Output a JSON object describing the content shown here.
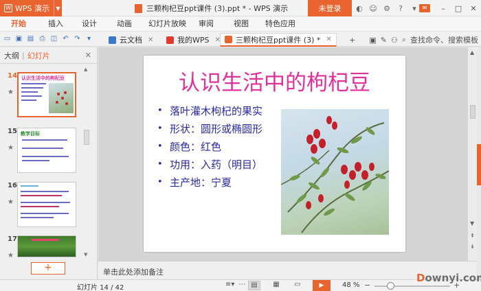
{
  "app": {
    "name": "WPS 演示",
    "document_title": "三颗枸杞豆ppt课件 (3).ppt * - WPS 演示",
    "login_label": "未登录"
  },
  "menu": {
    "items": [
      "开始",
      "插入",
      "设计",
      "动画",
      "幻灯片放映",
      "审阅",
      "视图",
      "特色应用"
    ],
    "active": "开始"
  },
  "tabs": [
    {
      "label": "云文档",
      "icon": "cloud-doc-icon",
      "color": "#3a78c9"
    },
    {
      "label": "我的WPS",
      "icon": "wps-logo-icon",
      "color": "#e23b2e"
    },
    {
      "label": "三颗枸杞豆ppt课件 (3) *",
      "icon": "ppt-file-icon",
      "color": "#e8632e",
      "active": true
    }
  ],
  "toolbar": {
    "search_label": "查找命令、搜索模板"
  },
  "left_panel": {
    "tab_outline": "大纲",
    "tab_slides": "幻灯片",
    "slides": [
      {
        "number": "14",
        "title": "认识生活中的枸杞豆",
        "current": true
      },
      {
        "number": "15",
        "title": "教学目标",
        "current": false
      },
      {
        "number": "16",
        "title": "",
        "current": false
      },
      {
        "number": "17",
        "title": "",
        "current": false
      }
    ],
    "add_label": "+"
  },
  "slide": {
    "title": "认识生活中的枸杞豆",
    "bullets": [
      "落叶灌木枸杞的果实",
      "形状：圆形或椭圆形",
      "颜色：红色",
      "功用：入药（明目）",
      "主产地：宁夏"
    ]
  },
  "notes": {
    "placeholder": "单击此处添加备注"
  },
  "status": {
    "slide_counter": "幻灯片 14 / 42",
    "zoom": "48 %",
    "zoom_level": 0.48
  },
  "watermark": {
    "text_a": "D",
    "text_b": "ownyi.com"
  },
  "colors": {
    "accent": "#e8632e",
    "title_pink": "#e0309a",
    "bullet_blue": "#2a2a9a"
  }
}
